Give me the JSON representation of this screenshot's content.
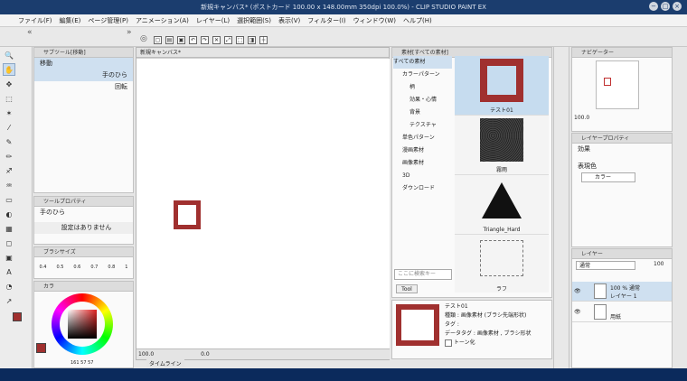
{
  "window": {
    "title": "新規キャンバス* (ポストカード 100.00 x 148.00mm 350dpi 100.0%) - CLIP STUDIO PAINT EX",
    "buttons": [
      "−",
      "□",
      "×"
    ]
  },
  "menu": [
    "ファイル(F)",
    "編集(E)",
    "ページ管理(P)",
    "アニメーション(A)",
    "レイヤー(L)",
    "選択範囲(S)",
    "表示(V)",
    "フィルター(I)",
    "ウィンドウ(W)",
    "ヘルプ(H)"
  ],
  "subtool": {
    "header": "サブツール[移動]",
    "group": "移動",
    "items": [
      "手のひら",
      "回転"
    ]
  },
  "tool_property": {
    "header": "ツールプロパティ",
    "tool_name": "手のひら",
    "settings_button": "設定はありません"
  },
  "brush_size": {
    "header": "ブラシサイズ",
    "values": [
      "0.4",
      "0.5",
      "0.6",
      "0.7",
      "0.8",
      "1"
    ]
  },
  "color": {
    "tab_label": "カラ",
    "main": "#a0302f",
    "sub": "#ffffff",
    "rgb_label": "161 57 57"
  },
  "canvas": {
    "tab": "新規キャンバス*",
    "zoom": "100.0",
    "angle": "0.0",
    "timeline_tab": "タイムライン",
    "red_square_color": "#a0302f"
  },
  "material": {
    "header": "素材[すべての素材]",
    "tree": [
      "すべての素材",
      "カラーパターン",
      "柄",
      "効果・心情",
      "背景",
      "テクスチャ",
      "単色パターン",
      "漫画素材",
      "画像素材",
      "3D",
      "ダウンロード"
    ],
    "search_placeholder": "ここに検索キー",
    "tag": "Tool",
    "thumbs": [
      "テスト01",
      "霧雨",
      "Triangle_Hard",
      "ラフ"
    ]
  },
  "material_detail": {
    "title": "テスト01",
    "kind": "種類 : 画像素材 (ブラシ先端形状)",
    "tags": "タグ :",
    "data_tags": "データタグ : 画像素材 , ブラシ形状",
    "tone": "トーン化"
  },
  "navigator": {
    "header": "ナビゲーター",
    "zoom": "100.0"
  },
  "layer_property": {
    "header": "レイヤープロパティ",
    "effect": "効果",
    "color_label": "表現色",
    "color_value": "カラー"
  },
  "layers": {
    "header": "レイヤー",
    "blend": "通常",
    "opacity": "100",
    "rows": [
      {
        "meta": "100 % 通常",
        "name": "レイヤー 1"
      },
      {
        "meta": "",
        "name": "用紙"
      }
    ]
  }
}
